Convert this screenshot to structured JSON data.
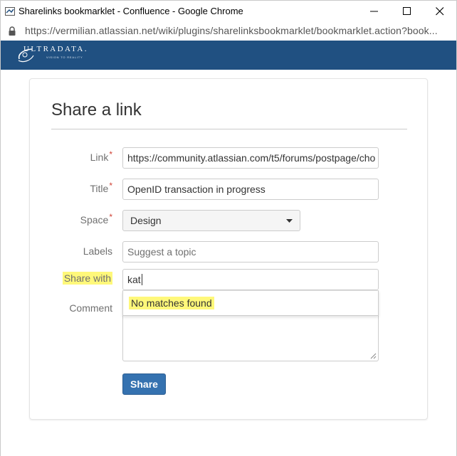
{
  "window": {
    "title": "Sharelinks bookmarklet - Confluence - Google Chrome",
    "url": "https://vermilian.atlassian.net/wiki/plugins/sharelinksbookmarklet/bookmarklet.action?book..."
  },
  "brand": {
    "name": "ULTRADATA.",
    "tagline": "VISION TO REALITY",
    "color": "#205081"
  },
  "form": {
    "heading": "Share a link",
    "required_marker": "*",
    "link": {
      "label": "Link",
      "value": "https://community.atlassian.com/t5/forums/postpage/cho"
    },
    "title": {
      "label": "Title",
      "value": "OpenID transaction in progress"
    },
    "space": {
      "label": "Space",
      "value": "Design"
    },
    "labels": {
      "label": "Labels",
      "placeholder": "Suggest a topic"
    },
    "share_with": {
      "label": "Share with",
      "value": "kat"
    },
    "suggestion": {
      "text": "No matches found"
    },
    "comment": {
      "label": "Comment",
      "value": ""
    },
    "submit_label": "Share"
  },
  "colors": {
    "highlight": "#fff87a",
    "primary_button": "#3572b0",
    "required": "#d04437"
  }
}
